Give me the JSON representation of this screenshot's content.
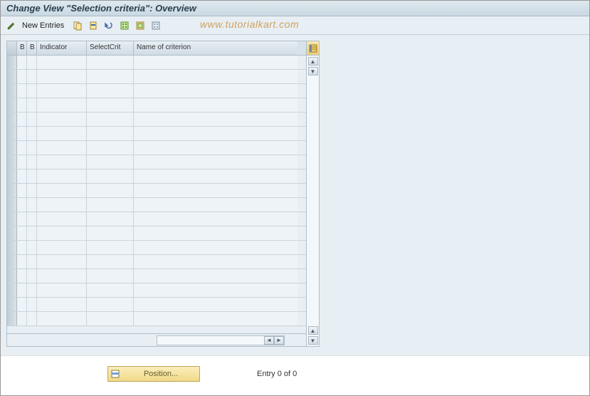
{
  "title": "Change View \"Selection criteria\": Overview",
  "toolbar": {
    "new_entries": "New Entries"
  },
  "watermark": "www.tutorialkart.com",
  "table": {
    "headers": {
      "b1": "B",
      "b2": "B",
      "indicator": "Indicator",
      "selectcrit": "SelectCrit",
      "name": "Name of criterion"
    },
    "row_count": 19
  },
  "footer": {
    "position_label": "Position...",
    "entry_text": "Entry 0 of 0"
  }
}
